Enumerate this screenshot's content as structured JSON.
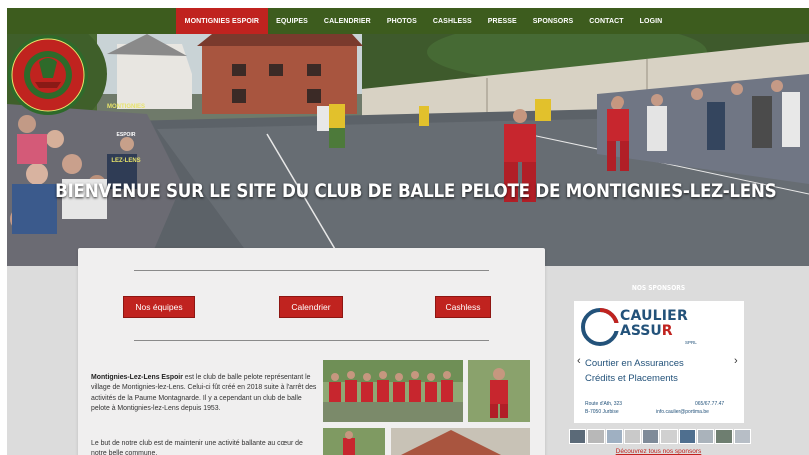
{
  "nav": {
    "items": [
      {
        "label": "MONTIGNIES ESPOIR",
        "active": true
      },
      {
        "label": "EQUIPES",
        "active": false
      },
      {
        "label": "CALENDRIER",
        "active": false
      },
      {
        "label": "PHOTOS",
        "active": false
      },
      {
        "label": "CASHLESS",
        "active": false
      },
      {
        "label": "PRESSE",
        "active": false
      },
      {
        "label": "SPONSORS",
        "active": false
      },
      {
        "label": "CONTACT",
        "active": false
      },
      {
        "label": "LOGIN",
        "active": false
      }
    ]
  },
  "hero": {
    "title": "BIENVENUE SUR LE SITE DU CLUB DE BALLE PELOTE DE MONTIGNIES-LEZ-LENS",
    "logo_top": "MONTIGNIES",
    "logo_mid": "ESPOIR",
    "logo_bottom": "LEZ-LENS"
  },
  "main": {
    "buttons": {
      "teams": "Nos équipes",
      "calendar": "Calendrier",
      "cashless": "Cashless"
    },
    "intro_bold": "Montignies-Lez-Lens Espoir",
    "intro_text": " est le club de balle pelote représentant le village de Montignies-lez-Lens. Celui-ci fût créé en 2018 suite à l'arrêt des activités de la Paume Montagnarde. Il y a cependant un club de balle pelote à Montignies-lez-Lens depuis 1953.",
    "intro_text2": "Le but de notre club est de maintenir une activité ballante au cœur de notre belle commune."
  },
  "sidebar": {
    "title": "NOS SPONSORS",
    "sponsor": {
      "brand_line1": "CAULIER",
      "brand_line2a": "ASSU",
      "brand_line2b": "R",
      "legal": "SPRL",
      "tagline1": "Courtier en Assurances",
      "tagline2": "Crédits et Placements",
      "address1": "Route d'Ath, 323",
      "address2": "B-7050 Jurbise",
      "phone": "065/67.77.47",
      "email": "info.caulier@portima.be",
      "prev_arrow": "‹",
      "next_arrow": "›"
    },
    "discover": "Découvrez tous nos sponsors"
  },
  "colors": {
    "nav_bg": "#3d5c1e",
    "accent_red": "#c0231f",
    "sponsor_blue": "#23527a"
  }
}
